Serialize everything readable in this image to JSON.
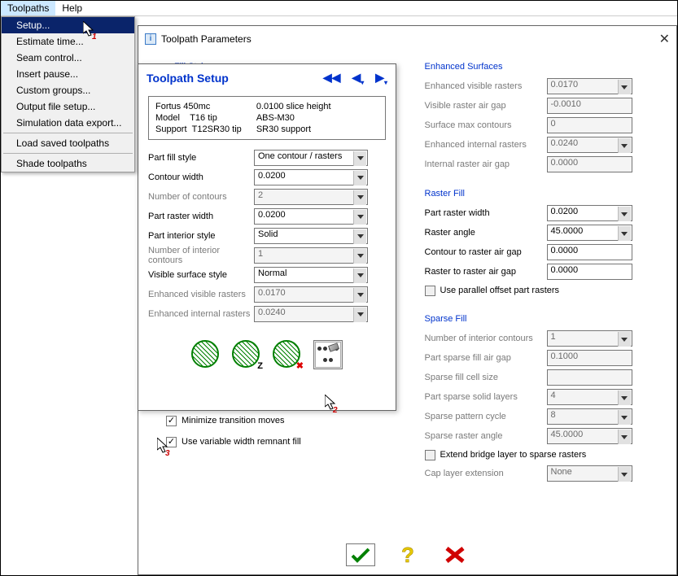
{
  "menubar": {
    "toolpaths": "Toolpaths",
    "help": "Help"
  },
  "menu": {
    "setup": "Setup...",
    "estimate": "Estimate time...",
    "seam": "Seam control...",
    "pause": "Insert pause...",
    "custom": "Custom groups...",
    "output": "Output file setup...",
    "sim": "Simulation data export...",
    "load": "Load saved toolpaths",
    "shade": "Shade toolpaths"
  },
  "dialog": {
    "title": "Toolpath Parameters",
    "left": {
      "fill_style": "Fill Style",
      "minimize": "Minimize transition moves",
      "remnant": "Use variable width remnant fill"
    },
    "enhanced": {
      "title": "Enhanced Surfaces",
      "visible_rasters": {
        "lbl": "Enhanced visible rasters",
        "val": "0.0170"
      },
      "air_gap": {
        "lbl": "Visible raster air gap",
        "val": "-0.0010"
      },
      "max_contours": {
        "lbl": "Surface max contours",
        "val": "0"
      },
      "internal_rasters": {
        "lbl": "Enhanced internal rasters",
        "val": "0.0240"
      },
      "internal_air_gap": {
        "lbl": "Internal raster air gap",
        "val": "0.0000"
      }
    },
    "raster": {
      "title": "Raster Fill",
      "part_width": {
        "lbl": "Part raster width",
        "val": "0.0200"
      },
      "angle": {
        "lbl": "Raster angle",
        "val": "45.0000"
      },
      "contour_gap": {
        "lbl": "Contour to raster air gap",
        "val": "0.0000"
      },
      "raster_gap": {
        "lbl": "Raster to raster air gap",
        "val": "0.0000"
      },
      "parallel": "Use parallel offset part rasters"
    },
    "sparse": {
      "title": "Sparse Fill",
      "interior": {
        "lbl": "Number of interior contours",
        "val": "1"
      },
      "air_gap": {
        "lbl": "Part sparse fill air gap",
        "val": "0.1000"
      },
      "cell": {
        "lbl": "Sparse fill cell size",
        "val": ""
      },
      "solid": {
        "lbl": "Part sparse solid layers",
        "val": "4"
      },
      "cycle": {
        "lbl": "Sparse pattern cycle",
        "val": "8"
      },
      "angle": {
        "lbl": "Sparse raster angle",
        "val": "45.0000"
      },
      "bridge": "Extend bridge layer to sparse rasters",
      "cap": {
        "lbl": "Cap layer extension",
        "val": "None"
      }
    }
  },
  "popup": {
    "title": "Toolpath Setup",
    "machine": {
      "name": "Fortus 450mc",
      "model_lbl": "Model",
      "model_tip": "T16 tip",
      "support_lbl": "Support",
      "support_tip": "T12SR30 tip",
      "slice": "0.0100 slice height",
      "mat": "ABS-M30",
      "sup": "SR30 support"
    },
    "rows": {
      "fill_style": {
        "lbl": "Part fill style",
        "val": "One contour / rasters"
      },
      "contour_width": {
        "lbl": "Contour width",
        "val": "0.0200"
      },
      "num_contours": {
        "lbl": "Number of contours",
        "val": "2"
      },
      "raster_width": {
        "lbl": "Part raster width",
        "val": "0.0200"
      },
      "interior": {
        "lbl": "Part interior style",
        "val": "Solid"
      },
      "interior_contours": {
        "lbl": "Number of interior contours",
        "val": "1"
      },
      "surface": {
        "lbl": "Visible surface style",
        "val": "Normal"
      },
      "evr": {
        "lbl": "Enhanced visible rasters",
        "val": "0.0170"
      },
      "eir": {
        "lbl": "Enhanced internal rasters",
        "val": "0.0240"
      }
    }
  },
  "cursor_nums": {
    "c1": "1",
    "c2": "2",
    "c3": "3"
  }
}
